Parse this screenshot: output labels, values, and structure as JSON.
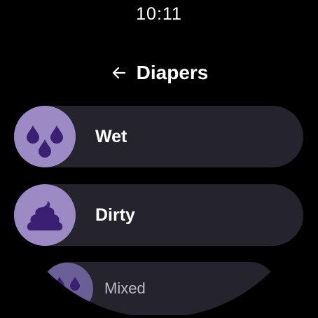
{
  "status": {
    "time": "10:11"
  },
  "header": {
    "title": "Diapers",
    "back_icon": "arrow-left-icon"
  },
  "options": [
    {
      "label": "Wet",
      "icon": "droplets-icon"
    },
    {
      "label": "Dirty",
      "icon": "poop-icon"
    },
    {
      "label": "Mixed",
      "icon": "mixed-icon"
    }
  ],
  "colors": {
    "background": "#000000",
    "chip": "#25232c",
    "icon_circle": "#9c8ac5",
    "icon_glyph": "#3b1f73"
  }
}
